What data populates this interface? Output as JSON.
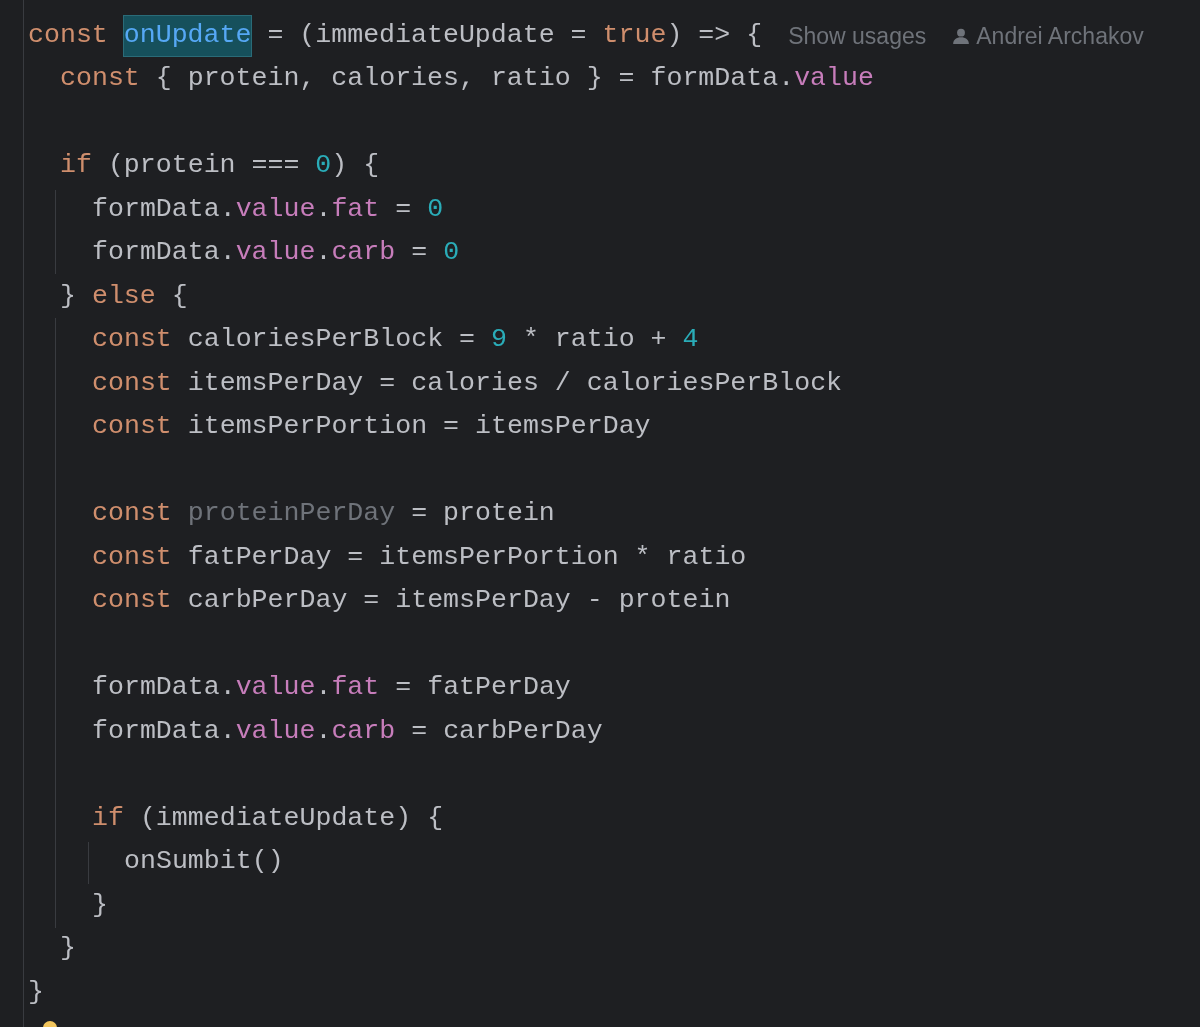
{
  "editor": {
    "lines": [
      {
        "kind": "code",
        "tokens": [
          {
            "kind": "keyword",
            "text": "const "
          },
          {
            "kind": "definition",
            "text": "onUpdate"
          },
          {
            "kind": "plain",
            "text": " = (immediateUpdate = "
          },
          {
            "kind": "keyword",
            "text": "true"
          },
          {
            "kind": "plain",
            "text": ") => {"
          },
          {
            "kind": "hint",
            "text": "Show usages"
          },
          {
            "kind": "author",
            "text": "Andrei Archakov"
          }
        ],
        "children": [
          {
            "kind": "code",
            "tokens": [
              {
                "kind": "keyword",
                "text": "const"
              },
              {
                "kind": "plain",
                "text": " { protein, calories, ratio } = formData."
              },
              {
                "kind": "field",
                "text": "value"
              }
            ]
          },
          {
            "kind": "blank"
          },
          {
            "kind": "code",
            "tokens": [
              {
                "kind": "keyword",
                "text": "if"
              },
              {
                "kind": "plain",
                "text": " (protein === "
              },
              {
                "kind": "number",
                "text": "0"
              },
              {
                "kind": "plain",
                "text": ") {"
              }
            ],
            "children": [
              {
                "kind": "code",
                "tokens": [
                  {
                    "kind": "plain",
                    "text": "formData."
                  },
                  {
                    "kind": "field",
                    "text": "value"
                  },
                  {
                    "kind": "plain",
                    "text": "."
                  },
                  {
                    "kind": "field",
                    "text": "fat"
                  },
                  {
                    "kind": "plain",
                    "text": " = "
                  },
                  {
                    "kind": "number",
                    "text": "0"
                  }
                ]
              },
              {
                "kind": "code",
                "tokens": [
                  {
                    "kind": "plain",
                    "text": "formData."
                  },
                  {
                    "kind": "field",
                    "text": "value"
                  },
                  {
                    "kind": "plain",
                    "text": "."
                  },
                  {
                    "kind": "field",
                    "text": "carb"
                  },
                  {
                    "kind": "plain",
                    "text": " = "
                  },
                  {
                    "kind": "number",
                    "text": "0"
                  }
                ]
              }
            ]
          },
          {
            "kind": "code",
            "tokens": [
              {
                "kind": "plain",
                "text": "} "
              },
              {
                "kind": "keyword",
                "text": "else"
              },
              {
                "kind": "plain",
                "text": " {"
              }
            ],
            "children": [
              {
                "kind": "code",
                "tokens": [
                  {
                    "kind": "keyword",
                    "text": "const"
                  },
                  {
                    "kind": "plain",
                    "text": " caloriesPerBlock = "
                  },
                  {
                    "kind": "number",
                    "text": "9"
                  },
                  {
                    "kind": "plain",
                    "text": " * ratio + "
                  },
                  {
                    "kind": "number",
                    "text": "4"
                  }
                ]
              },
              {
                "kind": "code",
                "tokens": [
                  {
                    "kind": "keyword",
                    "text": "const"
                  },
                  {
                    "kind": "plain",
                    "text": " itemsPerDay = calories / caloriesPerBlock"
                  }
                ]
              },
              {
                "kind": "code",
                "tokens": [
                  {
                    "kind": "keyword",
                    "text": "const"
                  },
                  {
                    "kind": "plain",
                    "text": " itemsPerPortion = itemsPerDay"
                  }
                ]
              },
              {
                "kind": "blank"
              },
              {
                "kind": "code",
                "tokens": [
                  {
                    "kind": "keyword",
                    "text": "const "
                  },
                  {
                    "kind": "unused",
                    "text": "proteinPerDay"
                  },
                  {
                    "kind": "plain",
                    "text": " = protein"
                  }
                ]
              },
              {
                "kind": "code",
                "tokens": [
                  {
                    "kind": "keyword",
                    "text": "const"
                  },
                  {
                    "kind": "plain",
                    "text": " fatPerDay = itemsPerPortion * ratio"
                  }
                ]
              },
              {
                "kind": "code",
                "tokens": [
                  {
                    "kind": "keyword",
                    "text": "const"
                  },
                  {
                    "kind": "plain",
                    "text": " carbPerDay = itemsPerDay - protein"
                  }
                ]
              },
              {
                "kind": "blank"
              },
              {
                "kind": "code",
                "tokens": [
                  {
                    "kind": "plain",
                    "text": "formData."
                  },
                  {
                    "kind": "field",
                    "text": "value"
                  },
                  {
                    "kind": "plain",
                    "text": "."
                  },
                  {
                    "kind": "field",
                    "text": "fat"
                  },
                  {
                    "kind": "plain",
                    "text": " = fatPerDay"
                  }
                ]
              },
              {
                "kind": "code",
                "tokens": [
                  {
                    "kind": "plain",
                    "text": "formData."
                  },
                  {
                    "kind": "field",
                    "text": "value"
                  },
                  {
                    "kind": "plain",
                    "text": "."
                  },
                  {
                    "kind": "field",
                    "text": "carb"
                  },
                  {
                    "kind": "plain",
                    "text": " = carbPerDay"
                  }
                ]
              },
              {
                "kind": "blank"
              },
              {
                "kind": "code",
                "tokens": [
                  {
                    "kind": "keyword",
                    "text": "if"
                  },
                  {
                    "kind": "plain",
                    "text": " (immediateUpdate) {"
                  }
                ],
                "children": [
                  {
                    "kind": "code",
                    "tokens": [
                      {
                        "kind": "plain",
                        "text": "onSumbit()"
                      }
                    ]
                  }
                ]
              },
              {
                "kind": "code",
                "tokens": [
                  {
                    "kind": "plain",
                    "text": "}"
                  }
                ]
              }
            ]
          },
          {
            "kind": "code",
            "tokens": [
              {
                "kind": "plain",
                "text": "}"
              }
            ]
          }
        ]
      },
      {
        "kind": "code",
        "tokens": [
          {
            "kind": "plain",
            "text": "}"
          }
        ]
      }
    ]
  }
}
